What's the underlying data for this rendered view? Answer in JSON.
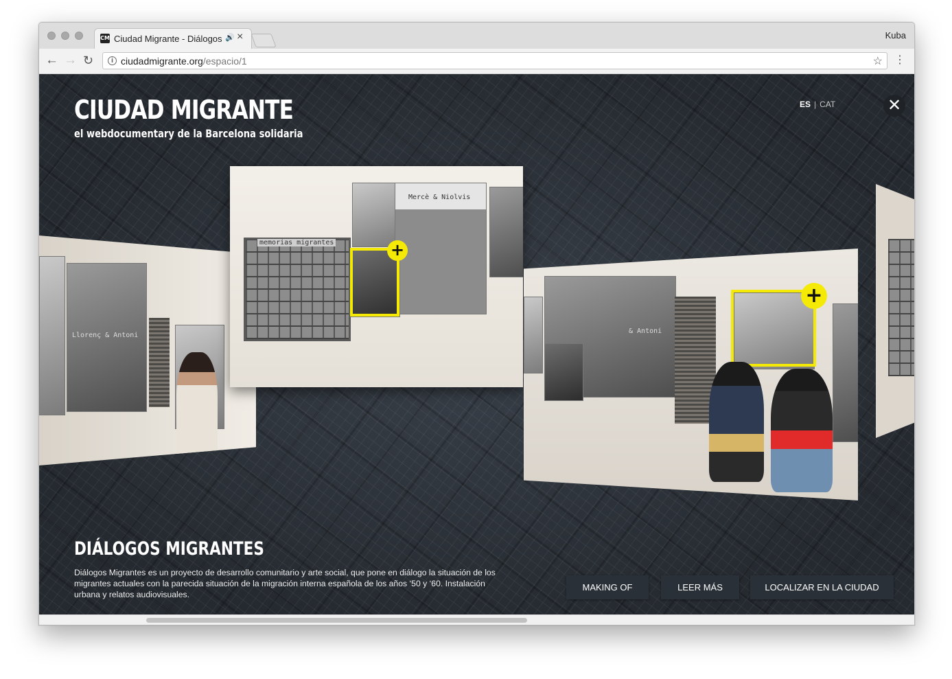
{
  "browser": {
    "tab_title": "Ciudad Migrante - Diálogos",
    "favicon_label": "CM",
    "profile_name": "Kuba",
    "url_host": "ciudadmigrante.org",
    "url_path": "/espacio/1"
  },
  "header": {
    "title": "CIUDAD MIGRANTE",
    "subtitle": "el webdocumentary de la Barcelona solidaria",
    "lang_es": "ES",
    "lang_sep": "|",
    "lang_cat": "CAT",
    "close_symbol": "✕"
  },
  "gallery": {
    "center_collage_caption": "memorias migrantes",
    "center_poster_caption": "Mercè & Niolvis",
    "left_poster_caption": "Llorenç & Antoni",
    "right_poster_caption": "& Antoni",
    "hotspot_symbol": "+"
  },
  "section": {
    "title": "DIÁLOGOS MIGRANTES",
    "description": "Diálogos Migrantes es un proyecto de desarrollo comunitario y arte social, que pone en diálogo la situación de los migrantes actuales con la parecida situación de la migración interna española de los años ‘50 y ‘60. Instalación urbana y relatos audiovisuales."
  },
  "actions": {
    "making_of": "MAKING OF",
    "leer_mas": "LEER MÁS",
    "localizar": "LOCALIZAR EN LA CIUDAD"
  },
  "colors": {
    "accent_yellow": "#f5ea05",
    "button_bg": "#2a3037",
    "map_bg": "#2b3138"
  },
  "icons": {
    "back": "back-arrow-icon",
    "forward": "forward-arrow-icon",
    "reload": "reload-icon",
    "info": "info-icon",
    "bookmark": "star-icon",
    "menu": "kebab-menu-icon",
    "audio": "speaker-icon",
    "close": "close-icon",
    "hotspot": "plus-icon"
  }
}
